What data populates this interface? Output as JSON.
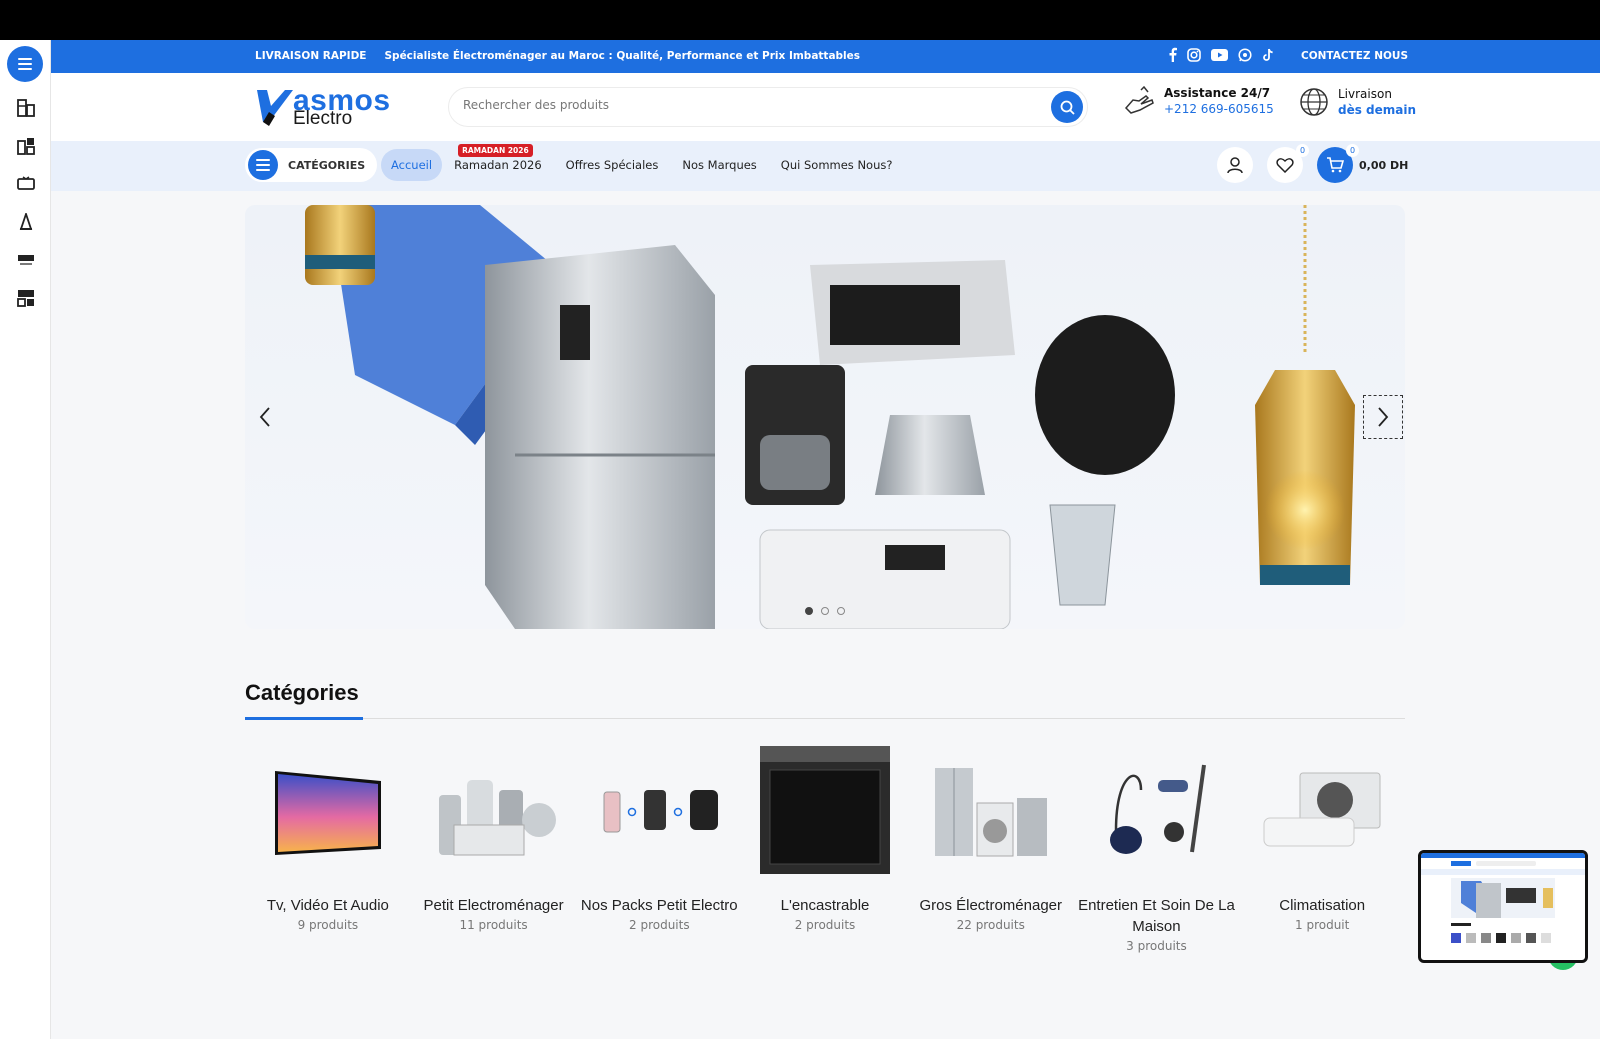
{
  "topbar": {
    "fast_delivery": "LIVRAISON RAPIDE",
    "tagline": "Spécialiste Électroménager au Maroc : Qualité, Performance et Prix Imbattables",
    "contact": "CONTACTEZ NOUS",
    "social_icons": [
      "facebook-icon",
      "instagram-icon",
      "youtube-icon",
      "whatsapp-icon",
      "tiktok-icon"
    ]
  },
  "header": {
    "logo_top": "asmos",
    "logo_bottom": "Electro",
    "search_placeholder": "Rechercher des produits",
    "assist_title": "Assistance 24/7",
    "assist_phone": "+212 669-605615",
    "delivery_title": "Livraison",
    "delivery_sub": "dès demain"
  },
  "nav": {
    "categories_label": "CATÉGORIES",
    "items": [
      "Accueil",
      "Ramadan 2026",
      "Offres Spéciales",
      "Nos Marques",
      "Qui Sommes Nous?"
    ],
    "ramadan_badge": "RAMADAN 2026",
    "wishlist_count": "0",
    "cart_count": "0",
    "cart_total": "0,00 DH"
  },
  "section": {
    "title": "Catégories"
  },
  "categories": [
    {
      "name": "Tv, Vidéo Et Audio",
      "count": "9 produits"
    },
    {
      "name": "Petit Electroménager",
      "count": "11 produits"
    },
    {
      "name": "Nos Packs Petit Electro",
      "count": "2 produits"
    },
    {
      "name": "L'encastrable",
      "count": "2 produits"
    },
    {
      "name": "Gros Électroménager",
      "count": "22 produits"
    },
    {
      "name": "Entretien Et Soin De La Maison",
      "count": "3 produits"
    },
    {
      "name": "Climatisation",
      "count": "1 produit"
    }
  ],
  "colors": {
    "brand": "#1e6fe0",
    "badge": "#d61f26"
  }
}
